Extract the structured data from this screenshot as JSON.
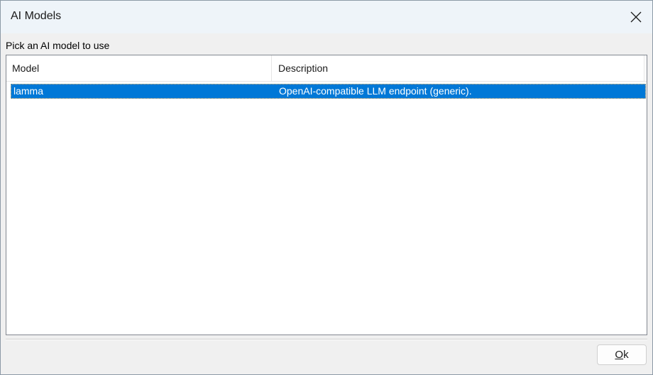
{
  "window": {
    "title": "AI Models",
    "close_icon": "close-icon"
  },
  "prompt": "Pick an AI model to use",
  "list": {
    "columns": [
      "Model",
      "Description"
    ],
    "rows": [
      {
        "model": "lamma",
        "description": "OpenAI-compatible LLM endpoint (generic).",
        "selected": true
      }
    ],
    "selection_color": "#0078d7"
  },
  "buttons": {
    "ok_mnemonic": "O",
    "ok_rest": "k"
  }
}
